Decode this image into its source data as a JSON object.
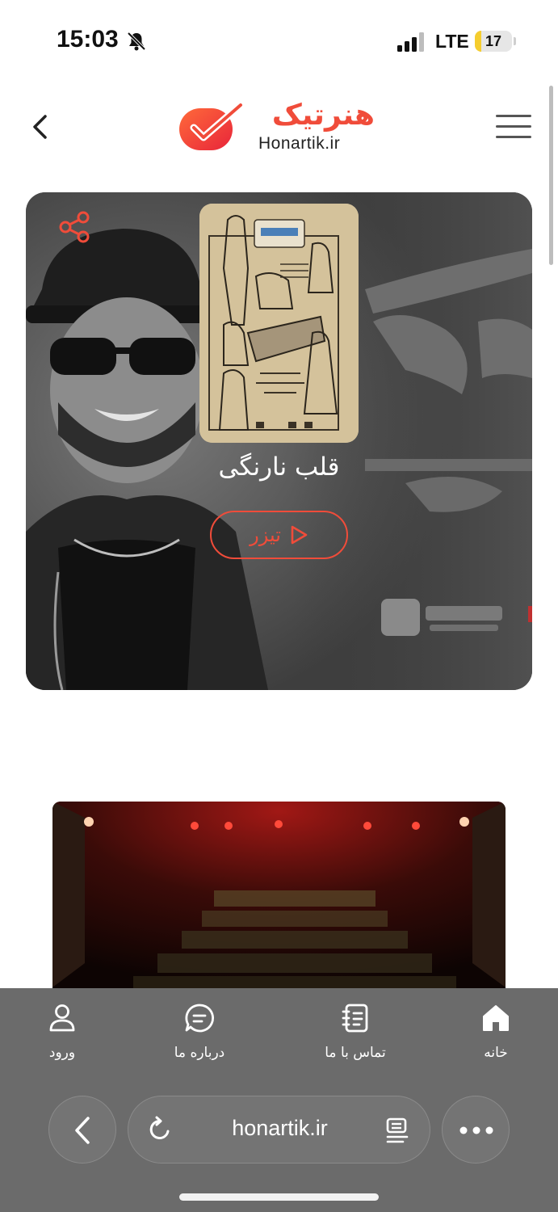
{
  "status_bar": {
    "time": "15:03",
    "network": "LTE",
    "battery_level": "17",
    "battery_fraction": 0.17,
    "icons": [
      "bell-slash-icon",
      "signal-icon"
    ]
  },
  "header": {
    "logo_text_fa": "هنرتیک",
    "logo_text_en": "Honartik.ir",
    "icons": [
      "back-chevron-icon",
      "menu-icon"
    ],
    "brand_color": "#f04c3a"
  },
  "hero": {
    "title": "قلب نارنگی",
    "teaser_label": "تیزر",
    "icons": [
      "share-icon",
      "play-icon"
    ]
  },
  "bottom_nav": {
    "items": [
      {
        "label": "خانه",
        "icon": "home-icon"
      },
      {
        "label": "تماس با ما",
        "icon": "contact-book-icon"
      },
      {
        "label": "درباره ما",
        "icon": "chat-icon"
      },
      {
        "label": "ورود",
        "icon": "user-icon"
      }
    ]
  },
  "browser": {
    "url": "honartik.ir",
    "icons": [
      "back-icon",
      "reload-icon",
      "reader-icon",
      "more-icon"
    ]
  },
  "colors": {
    "accent": "#f04c3a",
    "nav_background": "#6b6b6b",
    "hero_background": "#474747"
  }
}
